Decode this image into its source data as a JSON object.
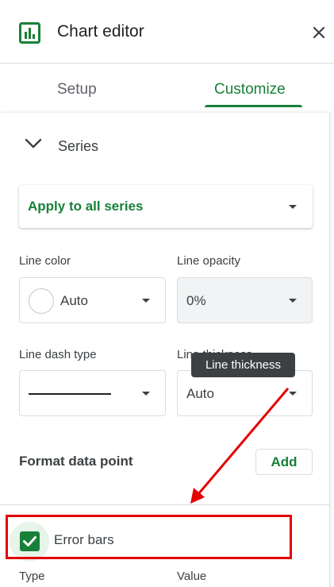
{
  "header": {
    "title": "Chart editor",
    "icon": "bar-chart-icon",
    "close_icon": "close-icon",
    "accent_color": "#188038"
  },
  "tabs": [
    {
      "label": "Setup",
      "active": false
    },
    {
      "label": "Customize",
      "active": true
    }
  ],
  "series_section": {
    "label": "Series",
    "expanded": true,
    "apply_to": "Apply to all series"
  },
  "fields": {
    "line_color": {
      "label": "Line color",
      "value": "Auto"
    },
    "line_opacity": {
      "label": "Line opacity",
      "value": "0%"
    },
    "line_dash_type": {
      "label": "Line dash type"
    },
    "line_thickness": {
      "label": "Line thickness",
      "value": "Auto"
    }
  },
  "tooltip": {
    "text": "Line thickness"
  },
  "format_data_point": {
    "label": "Format data point",
    "add_label": "Add"
  },
  "error_bars": {
    "label": "Error bars",
    "checked": true
  },
  "bottom_labels": {
    "type": "Type",
    "value": "Value"
  },
  "annotation": {
    "highlight_color": "#e60000"
  }
}
